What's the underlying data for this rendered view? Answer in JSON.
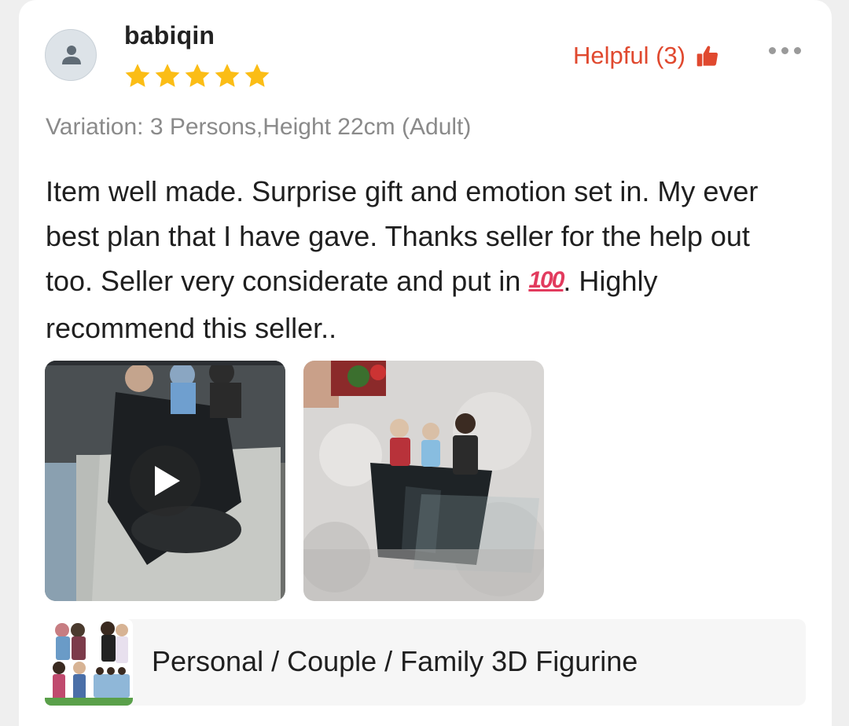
{
  "review": {
    "username": "babiqin",
    "rating": 5,
    "rating_max": 5,
    "helpful_label": "Helpful (3)",
    "variation": "Variation: 3 Persons,Height 22cm (Adult)",
    "text_before_emoji": "Item well made. Surprise gift and emotion set in. My ever best plan that I have gave. Thanks seller for the help out too. Seller very considerate and put in ",
    "emoji": "100",
    "text_after_emoji": ". Highly recommend this seller..",
    "media": [
      {
        "type": "video",
        "icon": "play-icon"
      },
      {
        "type": "photo"
      }
    ]
  },
  "product": {
    "name": "Personal / Couple / Family 3D Figurine"
  },
  "colors": {
    "accent": "#e0492f",
    "star": "#fbbd16",
    "emoji": "#e23b5e"
  },
  "icons": [
    "user-icon",
    "star-icon",
    "thumbs-up-icon",
    "more-icon",
    "play-icon"
  ]
}
